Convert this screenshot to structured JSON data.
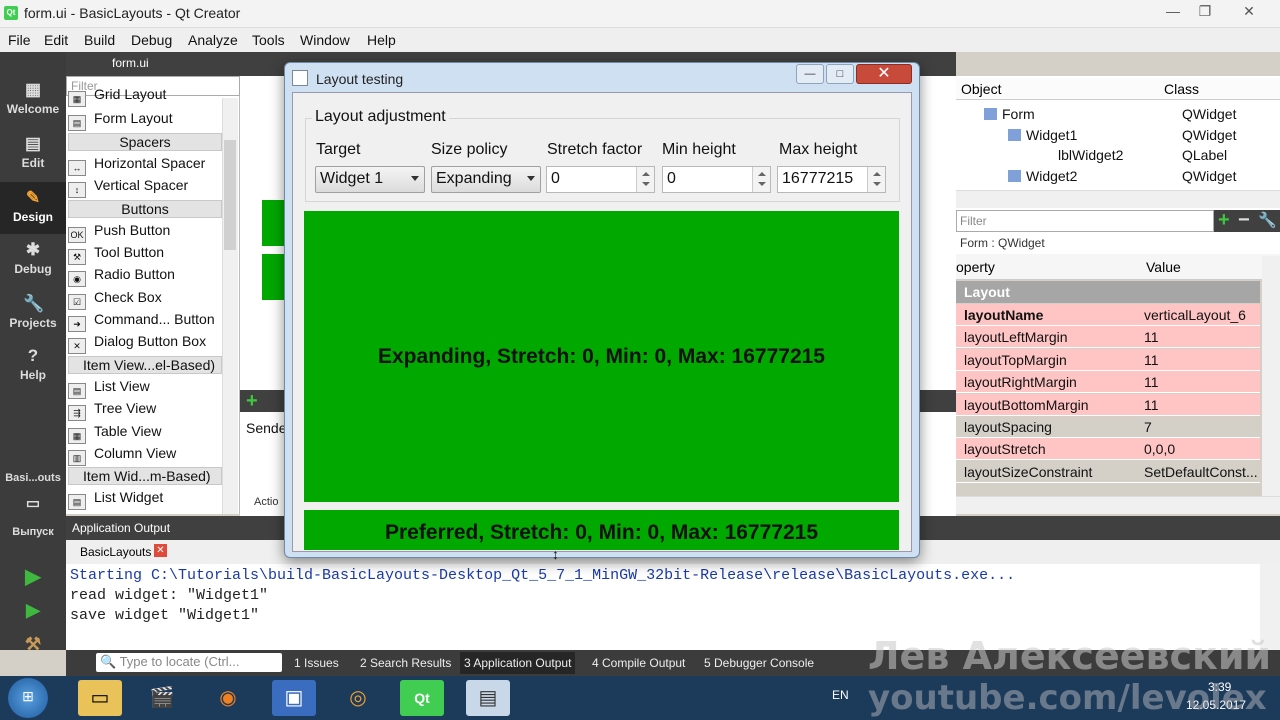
{
  "window": {
    "title": "form.ui - BasicLayouts - Qt Creator",
    "min": "—",
    "max": "❐",
    "close": "✕"
  },
  "menu": [
    "File",
    "Edit",
    "Build",
    "Debug",
    "Analyze",
    "Tools",
    "Window",
    "Help"
  ],
  "modes": [
    {
      "label": "Welcome",
      "icon": "▦"
    },
    {
      "label": "Edit",
      "icon": "▤"
    },
    {
      "label": "Design",
      "icon": "✎"
    },
    {
      "label": "Debug",
      "icon": "✱"
    },
    {
      "label": "Projects",
      "icon": "🔧"
    },
    {
      "label": "Help",
      "icon": "?"
    }
  ],
  "kit": {
    "label": "Basi...outs",
    "run_label": "Выпуск"
  },
  "form_tab": "form.ui",
  "widgetbox": {
    "filter_placeholder": "Filter",
    "items": [
      {
        "type": "item",
        "label": "Grid Layout"
      },
      {
        "type": "item",
        "label": "Form Layout"
      },
      {
        "type": "cat",
        "label": "Spacers"
      },
      {
        "type": "item",
        "label": "Horizontal Spacer"
      },
      {
        "type": "item",
        "label": "Vertical Spacer"
      },
      {
        "type": "cat",
        "label": "Buttons"
      },
      {
        "type": "item",
        "label": "Push Button"
      },
      {
        "type": "item",
        "label": "Tool Button"
      },
      {
        "type": "item",
        "label": "Radio Button"
      },
      {
        "type": "item",
        "label": "Check Box"
      },
      {
        "type": "item",
        "label": "Command... Button"
      },
      {
        "type": "item",
        "label": "Dialog Button Box"
      },
      {
        "type": "cat",
        "label": "Item View...el-Based)"
      },
      {
        "type": "item",
        "label": "List View"
      },
      {
        "type": "item",
        "label": "Tree View"
      },
      {
        "type": "item",
        "label": "Table View"
      },
      {
        "type": "item",
        "label": "Column View"
      },
      {
        "type": "cat",
        "label": "Item Wid...m-Based)"
      },
      {
        "type": "item",
        "label": "List Widget"
      }
    ]
  },
  "editor": {
    "sender_label": "Sende",
    "action_label": "Actio"
  },
  "objects": {
    "headers": [
      "Object",
      "Class"
    ],
    "rows": [
      {
        "name": "Form",
        "cls": "QWidget",
        "indent": 0
      },
      {
        "name": "Widget1",
        "cls": "QWidget",
        "indent": 1
      },
      {
        "name": "lblWidget2",
        "cls": "QLabel",
        "indent": 2
      },
      {
        "name": "Widget2",
        "cls": "QWidget",
        "indent": 1
      }
    ]
  },
  "properties": {
    "filter_placeholder": "Filter",
    "context": "Form : QWidget",
    "headers": [
      "operty",
      "Value"
    ],
    "section": "Layout",
    "rows": [
      {
        "k": "layoutName",
        "v": "verticalLayout_6",
        "style": "pink",
        "bold": true
      },
      {
        "k": "layoutLeftMargin",
        "v": "11",
        "style": "pink"
      },
      {
        "k": "layoutTopMargin",
        "v": "11",
        "style": "pink"
      },
      {
        "k": "layoutRightMargin",
        "v": "11",
        "style": "pink"
      },
      {
        "k": "layoutBottomMargin",
        "v": "11",
        "style": "pink"
      },
      {
        "k": "layoutSpacing",
        "v": "7",
        "style": "white"
      },
      {
        "k": "layoutStretch",
        "v": "0,0,0",
        "style": "pink"
      },
      {
        "k": "layoutSizeConstraint",
        "v": "SetDefaultConst...",
        "style": "white"
      }
    ]
  },
  "output": {
    "header": "Application Output",
    "tab": "BasicLayouts",
    "lines": [
      "Starting C:\\Tutorials\\build-BasicLayouts-Desktop_Qt_5_7_1_MinGW_32bit-Release\\release\\BasicLayouts.exe...",
      "read widget: \"Widget1\"",
      "save widget \"Widget1\""
    ]
  },
  "statusbar": {
    "locate_placeholder": "Type to locate (Ctrl...",
    "tabs": [
      "1  Issues",
      "2  Search Results",
      "3  Application Output",
      "4  Compile Output",
      "5  Debugger Console"
    ]
  },
  "taskbar": {
    "lang": "EN",
    "time": "3:39",
    "date": "12.05.2017"
  },
  "watermark": {
    "name": "Лев Алексеевский",
    "url": "youtube.com/levolex"
  },
  "dialog": {
    "title": "Layout testing",
    "group_title": "Layout adjustment",
    "labels": [
      "Target",
      "Size policy",
      "Stretch factor",
      "Min height",
      "Max height"
    ],
    "target": "Widget 1",
    "size_policy": "Expanding",
    "stretch": "0",
    "min_height": "0",
    "max_height": "16777215",
    "widget1_text": "Expanding, Stretch: 0, Min: 0, Max: 16777215",
    "widget2_text": "Preferred, Stretch: 0, Min: 0, Max: 16777215",
    "green": "#00a800"
  }
}
